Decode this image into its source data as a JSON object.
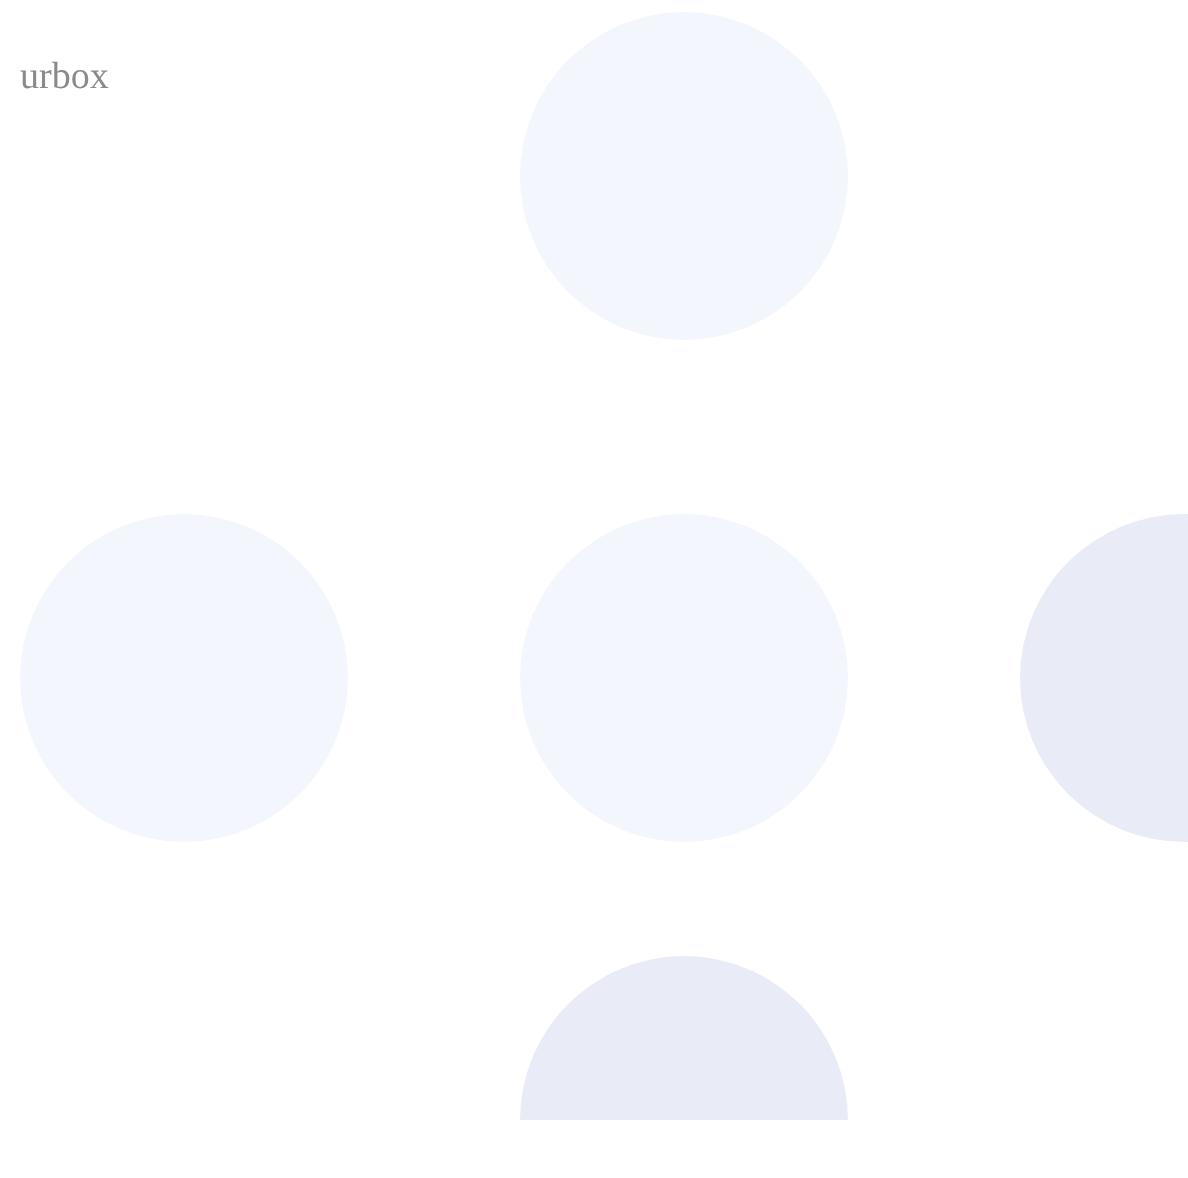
{
  "header": {
    "text": "urbox"
  }
}
